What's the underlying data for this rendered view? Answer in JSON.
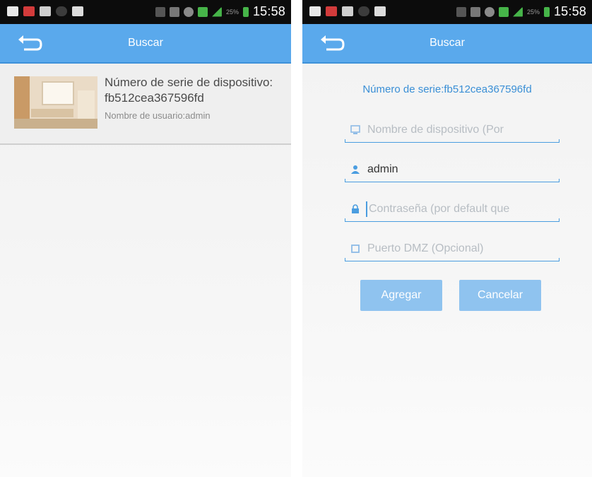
{
  "status_bar": {
    "time": "15:58",
    "battery_percent": "25%"
  },
  "left": {
    "appbar": {
      "title": "Buscar"
    },
    "device": {
      "serial_label": "Número de serie de dispositivo:",
      "serial_value": "fb512cea367596fd",
      "user_line": "Nombre de usuario:admin"
    }
  },
  "right": {
    "appbar": {
      "title": "Buscar"
    },
    "serial_header": "Número de serie:fb512cea367596fd",
    "fields": {
      "device_name_placeholder": "Nombre de dispositivo (Por",
      "username_value": "admin",
      "password_placeholder": "Contraseña (por default que",
      "dmz_port_placeholder": "Puerto DMZ (Opcional)"
    },
    "buttons": {
      "add": "Agregar",
      "cancel": "Cancelar"
    }
  },
  "colors": {
    "appbar": "#5aa9ec",
    "accent_text": "#3a8fd6",
    "button": "#8fc3ef",
    "field_line": "#4a9de0"
  },
  "icons": [
    "back-arrow-icon",
    "monitor-icon",
    "user-icon",
    "lock-icon",
    "port-icon"
  ]
}
